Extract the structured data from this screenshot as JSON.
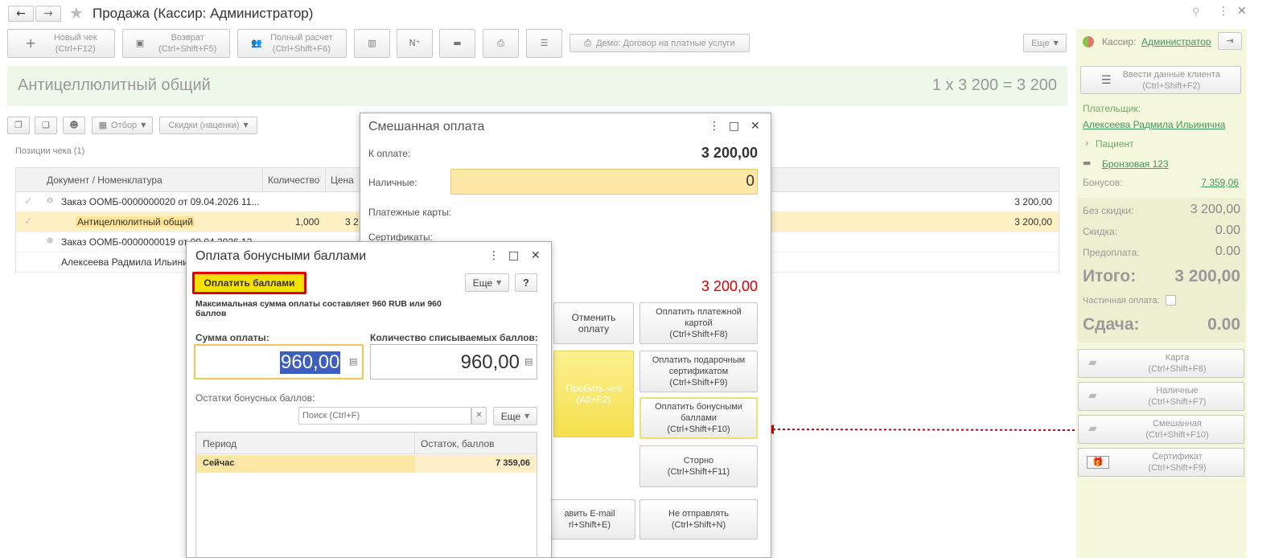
{
  "window": {
    "title": "Продажа (Кассир: Администратор)"
  },
  "toolbar": {
    "new_check": "Новый чек",
    "new_check_key": "(Ctrl+F12)",
    "return": "Возврат",
    "return_key": "(Ctrl+Shift+F5)",
    "full_calc": "Полный расчет",
    "full_calc_key": "(Ctrl+Shift+F6)",
    "contract": "Демо: Договор на платные услуги",
    "more": "Еще"
  },
  "product_banner": {
    "name": "Антицеллюлитный общий",
    "calc": "1 x 3 200 = 3 200"
  },
  "filters": {
    "filter": "Отбор",
    "discounts": "Скидки (наценки)"
  },
  "positions_label": "Позиции чека (1)",
  "table": {
    "headers": [
      "Документ / Номенклатура",
      "Количество",
      "Цена"
    ],
    "rows": [
      {
        "doc": "Заказ ООМБ-0000000020 от 09.04.2026 11...",
        "qty": "",
        "price": "",
        "sum": "3 200,00"
      },
      {
        "doc": "Антицеллюлитный общий",
        "qty": "1,000",
        "price": "3 2",
        "sum": "3 200,00"
      },
      {
        "doc": "Заказ ООМБ-0000000019 от 09.04.2026 12...",
        "qty": "",
        "price": "",
        "sum": ""
      },
      {
        "doc": "Алексеева Радмила Ильинич",
        "qty": "",
        "price": "",
        "sum": ""
      }
    ]
  },
  "sidebar": {
    "cashier_label": "Кассир:",
    "cashier": "Администратор",
    "client_btn": "Ввести данные клиента",
    "client_key": "(Ctrl+Shift+F2)",
    "payer_label": "Плательщик:",
    "payer": "Алексеева Радмила Ильинична",
    "patient": "Пациент",
    "card": "Бронзовая 123",
    "bonus_label": "Бонусов:",
    "bonus": "7 359,06",
    "no_discount_label": "Без скидки:",
    "no_discount": "3 200,00",
    "discount_label": "Скидка:",
    "discount": "0.00",
    "prepay_label": "Предоплата:",
    "prepay": "0.00",
    "total_label": "Итого:",
    "total": "3 200,00",
    "partial_label": "Частичная оплата:",
    "change_label": "Сдача:",
    "change": "0.00",
    "pay": [
      {
        "label": "Карта",
        "key": "(Ctrl+Shift+F8)"
      },
      {
        "label": "Наличные",
        "key": "(Ctrl+Shift+F7)"
      },
      {
        "label": "Смешанная",
        "key": "(Ctrl+Shift+F10)"
      },
      {
        "label": "Сертификат",
        "key": "(Ctrl+Shift+F9)"
      }
    ]
  },
  "mixed": {
    "title": "Смешанная оплата",
    "to_pay_label": "К оплате:",
    "to_pay": "3 200,00",
    "cash_label": "Наличные:",
    "cash": "0",
    "cards_label": "Платежные карты:",
    "certs_label": "Сертификаты:",
    "remaining": "3 200,00",
    "cancel": "Отменить оплату",
    "pay_card": "Оплатить платежной картой",
    "pay_card_key": "(Ctrl+Shift+F8)",
    "punch": "Пробить чек",
    "punch_key": "(Alt+F2)",
    "pay_gift": "Оплатить подарочным сертификатом",
    "pay_gift_key": "(Ctrl+Shift+F9)",
    "pay_bonus": "Оплатить бонусными баллами",
    "pay_bonus_key": "(Ctrl+Shift+F10)",
    "storno": "Сторно",
    "storno_key": "(Ctrl+Shift+F11)",
    "email": "авить E-mail",
    "email_key": "rl+Shift+E)",
    "no_send": "Не отправлять",
    "no_send_key": "(Ctrl+Shift+N)"
  },
  "bonus": {
    "title": "Оплата бонусными баллами",
    "pay_btn": "Оплатить баллами",
    "more": "Еще",
    "help": "?",
    "info": "Максимальная сумма оплаты составляет 960 RUB или 960 баллов",
    "sum_label": "Сумма оплаты:",
    "sum": "960,00",
    "points_label": "Количество списываемых баллов:",
    "points": "960,00",
    "rest_label": "Остатки бонусных баллов:",
    "search_placeholder": "Поиск (Ctrl+F)",
    "col_period": "Период",
    "col_rest": "Остаток, баллов",
    "row_period": "Сейчас",
    "row_rest": "7 359,06"
  },
  "colors": {
    "accent_green": "#eef8e8",
    "sidebar": "#f5f8dc",
    "highlight": "#fde7a6",
    "red": "#d40000",
    "link": "#3c9a5c"
  }
}
